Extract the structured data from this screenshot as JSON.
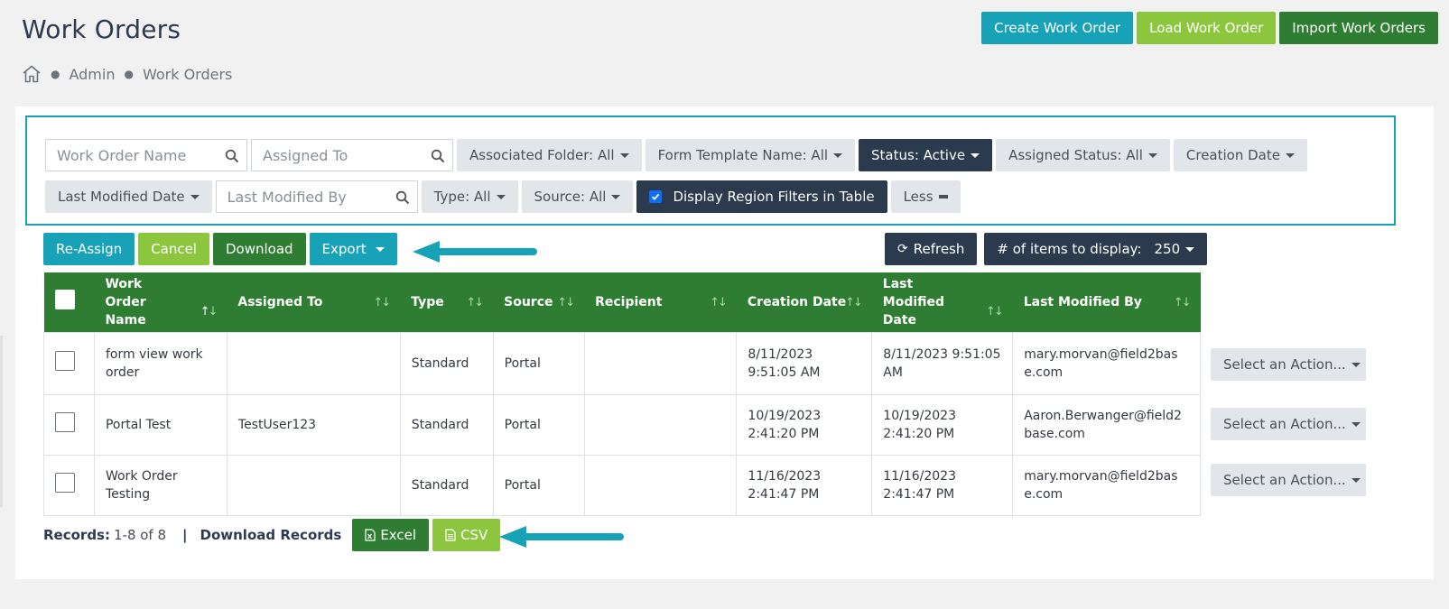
{
  "page": {
    "title": "Work Orders",
    "breadcrumb": [
      "Admin",
      "Work Orders"
    ]
  },
  "top_actions": {
    "create": "Create Work Order",
    "load": "Load Work Order",
    "import": "Import Work Orders"
  },
  "filters": {
    "work_order_name_placeholder": "Work Order Name",
    "assigned_to_placeholder": "Assigned To",
    "associated_folder": "Associated Folder: All",
    "form_template": "Form Template Name: All",
    "status": "Status: Active",
    "assigned_status": "Assigned Status: All",
    "creation_date": "Creation Date",
    "last_modified_date": "Last Modified Date",
    "last_modified_by_placeholder": "Last Modified By",
    "type": "Type: All",
    "source": "Source: All",
    "display_region": "Display Region Filters in Table",
    "display_region_checked": true,
    "less": "Less"
  },
  "actions": {
    "reassign": "Re-Assign",
    "cancel": "Cancel",
    "download": "Download",
    "export": "Export",
    "refresh": "Refresh",
    "items_label": "# of items to display:",
    "items_value": "250"
  },
  "table": {
    "columns": [
      "Work Order Name",
      "Assigned To",
      "Type",
      "Source",
      "Recipient",
      "Creation Date",
      "Last Modified Date",
      "Last Modified By"
    ],
    "rows": [
      {
        "name": "form view work order",
        "assigned_to": "",
        "type": "Standard",
        "source": "Portal",
        "recipient": "",
        "creation_date": "8/11/2023 9:51:05 AM",
        "last_modified_date": "8/11/2023 9:51:05 AM",
        "last_modified_by": "mary.morvan@field2base.com",
        "action": "Select an Action..."
      },
      {
        "name": "Portal Test",
        "assigned_to": "TestUser123",
        "type": "Standard",
        "source": "Portal",
        "recipient": "",
        "creation_date": "10/19/2023 2:41:20 PM",
        "last_modified_date": "10/19/2023 2:41:20 PM",
        "last_modified_by": "Aaron.Berwanger@field2base.com",
        "action": "Select an Action..."
      },
      {
        "name": "Work Order Testing",
        "assigned_to": "",
        "type": "Standard",
        "source": "Portal",
        "recipient": "",
        "creation_date": "11/16/2023 2:41:47 PM",
        "last_modified_date": "11/16/2023 2:41:47 PM",
        "last_modified_by": "mary.morvan@field2base.com",
        "action": "Select an Action..."
      }
    ]
  },
  "footer": {
    "records_label": "Records:",
    "records_value": "1-8 of 8",
    "separator": "|",
    "download_records": "Download Records",
    "excel": "Excel",
    "csv": "CSV"
  },
  "colors": {
    "teal": "#17a2b8",
    "lime": "#8cc63f",
    "green": "#2e7d32",
    "dark": "#2b3a4d"
  },
  "icons": [
    "home-icon",
    "search-icon",
    "refresh-icon",
    "minus-icon",
    "excel-file-icon",
    "csv-file-icon",
    "sort-icon",
    "arrow-indicator-icon"
  ]
}
